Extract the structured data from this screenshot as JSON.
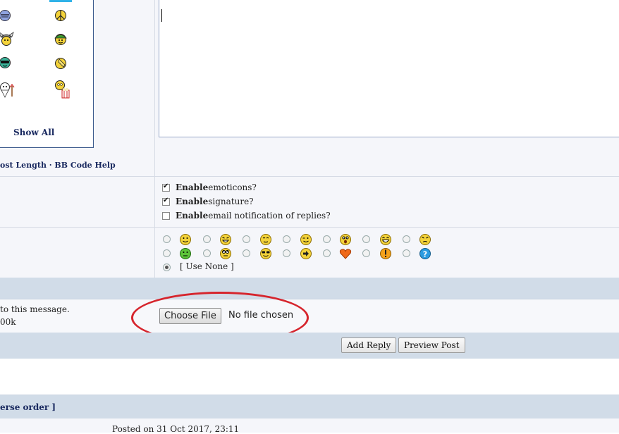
{
  "emoticons_panel": {
    "show_all_label": "Show All",
    "help_links": "ost Length · BB Code Help"
  },
  "options": [
    {
      "bold": "Enable",
      "rest": " emoticons?",
      "checked": true
    },
    {
      "bold": "Enable",
      "rest": " signature?",
      "checked": true
    },
    {
      "bold": "Enable",
      "rest": " email notification of replies?",
      "checked": false
    }
  ],
  "post_icons": {
    "use_none_label": "[ Use None ]",
    "selected": "use-none",
    "row1": [
      "smile-icon",
      "grin-wide-icon",
      "blush-icon",
      "wink-icon",
      "shocked-icon",
      "laugh-icon",
      "angry-icon"
    ],
    "row2": [
      "sick-icon",
      "rolleyes-icon",
      "cool-icon",
      "arrow-icon",
      "heart-icon",
      "exclamation-icon",
      "question-icon"
    ]
  },
  "attachments": {
    "text_line1": "to this message.",
    "text_line2": "00k",
    "choose_file_label": "Choose File",
    "file_status": "No file chosen"
  },
  "actions": {
    "add_reply_label": "Add Reply",
    "preview_label": "Preview Post"
  },
  "thread": {
    "reverse_order_label": "erse order ]",
    "posted_on": "Posted on 31 Oct 2017, 23:11"
  },
  "colors": {
    "bar": "#d1dce8",
    "highlight_oval": "#d6252d",
    "link": "#1a2a60"
  }
}
